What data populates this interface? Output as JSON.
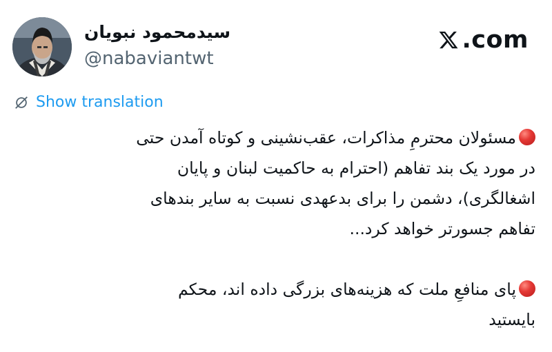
{
  "header": {
    "display_name": "سیدمحمود نبویان",
    "handle": "@nabaviantwt",
    "site": ".com",
    "logo_icon": "x-logo-icon"
  },
  "translate": {
    "label": "Show translation",
    "icon": "translate-icon"
  },
  "tweet": {
    "paragraph1": [
      "مسئولان محترمِ مذاکرات، عقب‌نشینی و کوتاه آمدن حتی",
      "در مورد یک بند تفاهم (احترام به حاکمیت لبنان و پایان",
      "اشغالگری)، دشمن را برای بدعهدی نسبت به سایر بندهای",
      "تفاهم جسورتر خواهد کرد..."
    ],
    "paragraph2": [
      "پای منافعِ ملت که هزینه‌های بزرگی  داده اند، محکم",
      "بایستید"
    ],
    "bullet_icon": "red-circle-icon",
    "bullet_color": "#e53935"
  },
  "colors": {
    "link": "#1d9bf0",
    "handle": "#536471",
    "text": "#0f1419"
  }
}
